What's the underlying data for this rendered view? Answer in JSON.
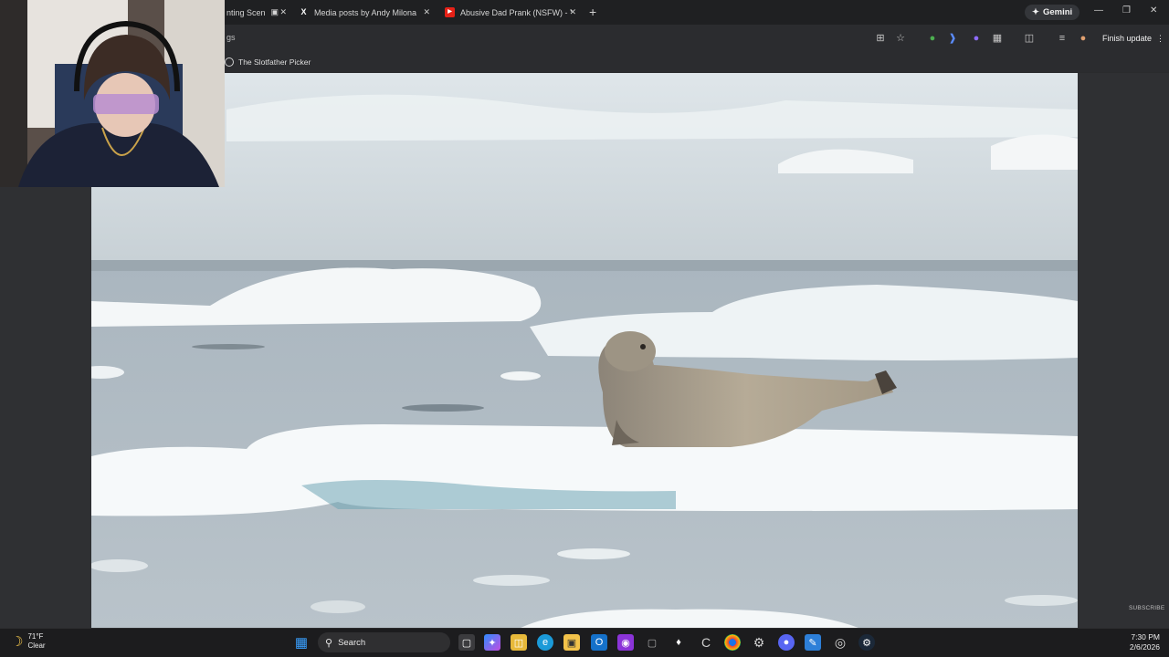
{
  "browser": {
    "tabs": [
      {
        "label": "nting Scen",
        "favicon": "tab-icon"
      },
      {
        "label": "Media posts by Andy Milonakis",
        "favicon": "x-logo-icon"
      },
      {
        "label": "Abusive Dad Prank (NSFW) - Yo",
        "favicon": "youtube-icon"
      }
    ],
    "gemini_label": "Gemini",
    "omnibox_text": "gs",
    "finish_update_label": "Finish update",
    "bookmark": {
      "label": "The Slotfather Picker",
      "icon": "globe-icon"
    }
  },
  "video": {
    "subscribe_label": "SUBSCRIBE",
    "scene": "seal-on-ice-floe"
  },
  "taskbar": {
    "weather": {
      "temp": "71°F",
      "condition": "Clear",
      "icon": "moon-icon"
    },
    "search_label": "Search",
    "clock": {
      "time": "7:30 PM",
      "date": "2/6/2026"
    }
  }
}
